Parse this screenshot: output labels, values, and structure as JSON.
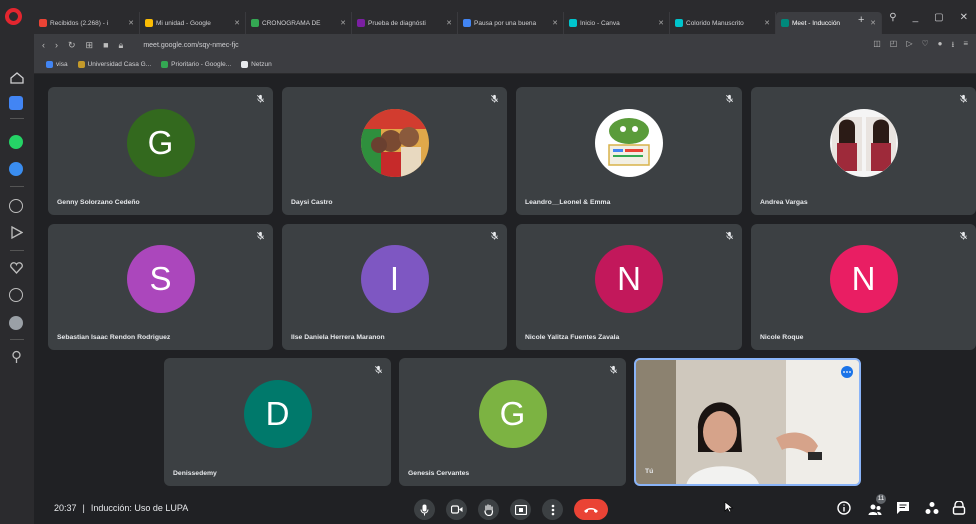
{
  "browser": {
    "tabs": [
      {
        "label": "Recibidos (2.268) - i",
        "color": "#ea4335"
      },
      {
        "label": "Mi unidad - Google",
        "color": "#fbbc04"
      },
      {
        "label": "CRONOGRAMA DE",
        "color": "#34a853"
      },
      {
        "label": "Prueba de diagnósti",
        "color": "#7b1fa2"
      },
      {
        "label": "Pausa por una buena",
        "color": "#4285f4"
      },
      {
        "label": "Inicio - Canva",
        "color": "#00c4cc"
      },
      {
        "label": "Colorido Manuscrito",
        "color": "#00c4cc"
      },
      {
        "label": "Meet - Inducción",
        "color": "#00897b",
        "active": true
      }
    ],
    "tab_close": "✕",
    "new_tab": "+",
    "window_controls": [
      "⚲",
      "_",
      "▢",
      "✕"
    ],
    "url": "meet.google.com/sqy-nmec-fjc",
    "bookmarks": [
      {
        "label": "visa",
        "color": "#4285f4"
      },
      {
        "label": "Universidad Casa G...",
        "color": "#c49a2a"
      },
      {
        "label": "Prioritario - Google...",
        "color": "#34a853"
      },
      {
        "label": "Netzun",
        "color": "#e8eaed"
      }
    ]
  },
  "participants": [
    {
      "name": "Genny Solorzano Cedeño",
      "initial": "G",
      "color": "#33691e"
    },
    {
      "name": "Daysi Castro",
      "initial": "",
      "color": ""
    },
    {
      "name": "Leandro__Leonel & Emma",
      "initial": "",
      "color": ""
    },
    {
      "name": "Andrea Vargas",
      "initial": "",
      "color": ""
    },
    {
      "name": "Sebastian Isaac Rendon Rodriguez",
      "initial": "S",
      "color": "#ab47bc"
    },
    {
      "name": "Ilse Daniela Herrera Maranon",
      "initial": "I",
      "color": "#7e57c2"
    },
    {
      "name": "Nicole Yalitza Fuentes Zavala",
      "initial": "N",
      "color": "#c2185b"
    },
    {
      "name": "Nicole Roque",
      "initial": "N",
      "color": "#e91e63"
    },
    {
      "name": "Denissedemy",
      "initial": "D",
      "color": "#00796b"
    },
    {
      "name": "Genesis Cervantes",
      "initial": "G",
      "color": "#7cb342"
    },
    {
      "name": "Tú",
      "initial": "",
      "color": ""
    }
  ],
  "meeting": {
    "time": "20:37",
    "separator": "|",
    "title": "Inducción: Uso de LUPA",
    "participant_badge": "11"
  },
  "colors": {
    "tile_bg": "#3c4043",
    "page_bg": "#202124",
    "hangup": "#ea4335",
    "self_border": "#8ab4f8"
  }
}
